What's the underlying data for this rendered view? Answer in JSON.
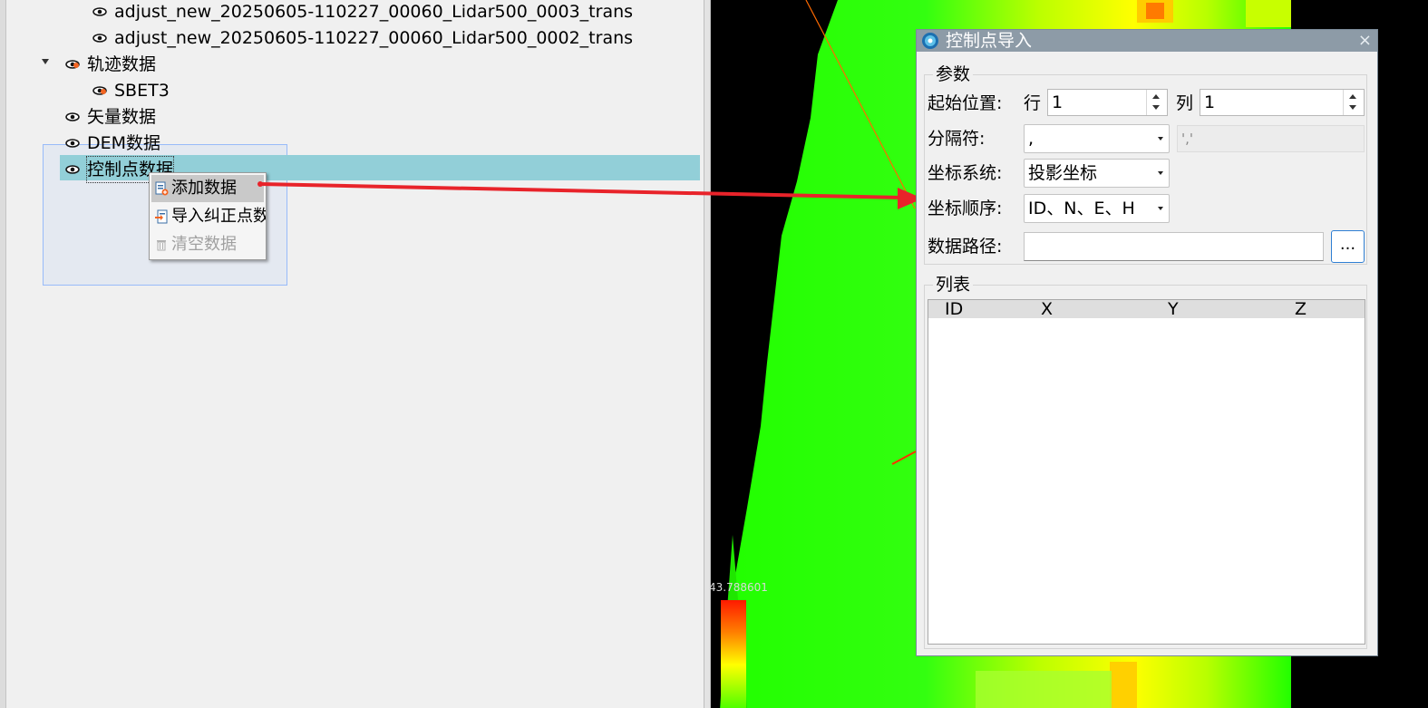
{
  "tree": {
    "items": [
      {
        "label": "adjust_new_20250605-110227_00060_Lidar500_0003_trans"
      },
      {
        "label": "adjust_new_20250605-110227_00060_Lidar500_0002_trans"
      },
      {
        "label": "轨迹数据"
      },
      {
        "label": "SBET3"
      },
      {
        "label": "矢量数据"
      },
      {
        "label": "DEM数据"
      },
      {
        "label": "控制点数据"
      }
    ]
  },
  "context_menu": {
    "items": [
      {
        "label": "添加数据",
        "state": "hover"
      },
      {
        "label": "导入纠正点数",
        "state": "enabled"
      },
      {
        "label": "清空数据",
        "state": "disabled"
      }
    ]
  },
  "view3d": {
    "legend_max": "43.788601"
  },
  "dialog": {
    "title": "控制点导入",
    "close": "×",
    "params": {
      "group_title": "参数",
      "start_label": "起始位置:",
      "row_label": "行",
      "row_value": "1",
      "col_label": "列",
      "col_value": "1",
      "separator_label": "分隔符:",
      "separator_value": ",",
      "separator_preview": "','",
      "coord_system_label": "坐标系统:",
      "coord_system_value": "投影坐标",
      "coord_order_label": "坐标顺序:",
      "coord_order_value": "ID、N、E、H",
      "path_label": "数据路径:",
      "path_value": "",
      "browse_label": "..."
    },
    "list": {
      "group_title": "列表",
      "columns": [
        "ID",
        "X",
        "Y",
        "Z"
      ]
    }
  },
  "colors": {
    "selection_highlight": "#92cfd8",
    "title_bar": "#8d9ba7",
    "annotation_arrow": "#e8232a",
    "point_green": "#2bff00",
    "point_yellow": "#ffff00"
  }
}
